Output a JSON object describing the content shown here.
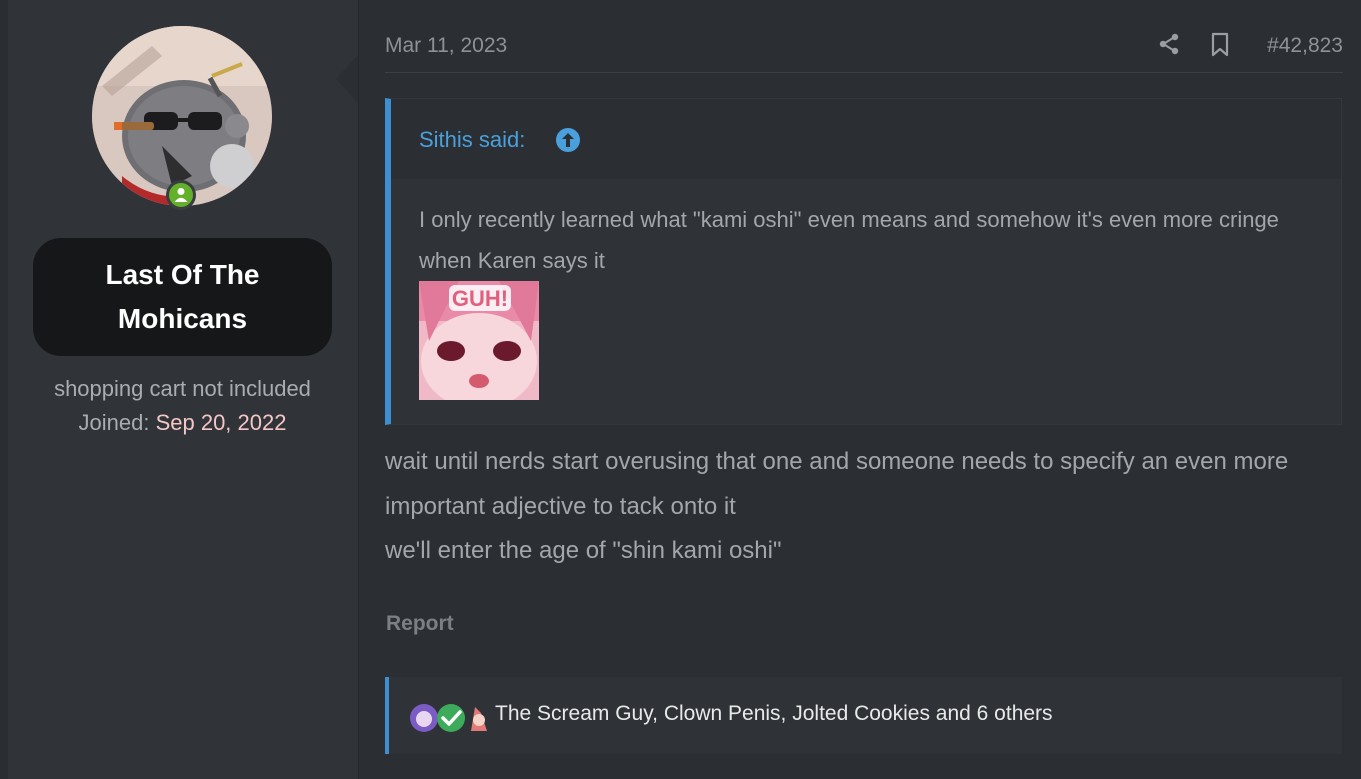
{
  "user": {
    "name": "Last Of The Mohicans",
    "title": "shopping cart not included",
    "joined_label": "Joined:",
    "joined_date": "Sep 20, 2022"
  },
  "post": {
    "date": "Mar 11, 2023",
    "number": "#42,823",
    "quote": {
      "author": "Sithis said:",
      "text": "I only recently learned what \"kami oshi\" even means and somehow it's even more cringe when Karen says it",
      "image_caption": "GUH!"
    },
    "message_lines": [
      "wait until nerds start overusing that one and someone needs to specify an even more important adjective to tack onto it",
      "we'll enter the age of \"shin kami oshi\""
    ],
    "report_label": "Report",
    "reactions_text": "The Scream Guy, Clown Penis, Jolted Cookies and 6 others"
  },
  "colors": {
    "accent": "#3d8fd1",
    "online": "#63b12a",
    "joined_date": "#f4c6c6"
  }
}
